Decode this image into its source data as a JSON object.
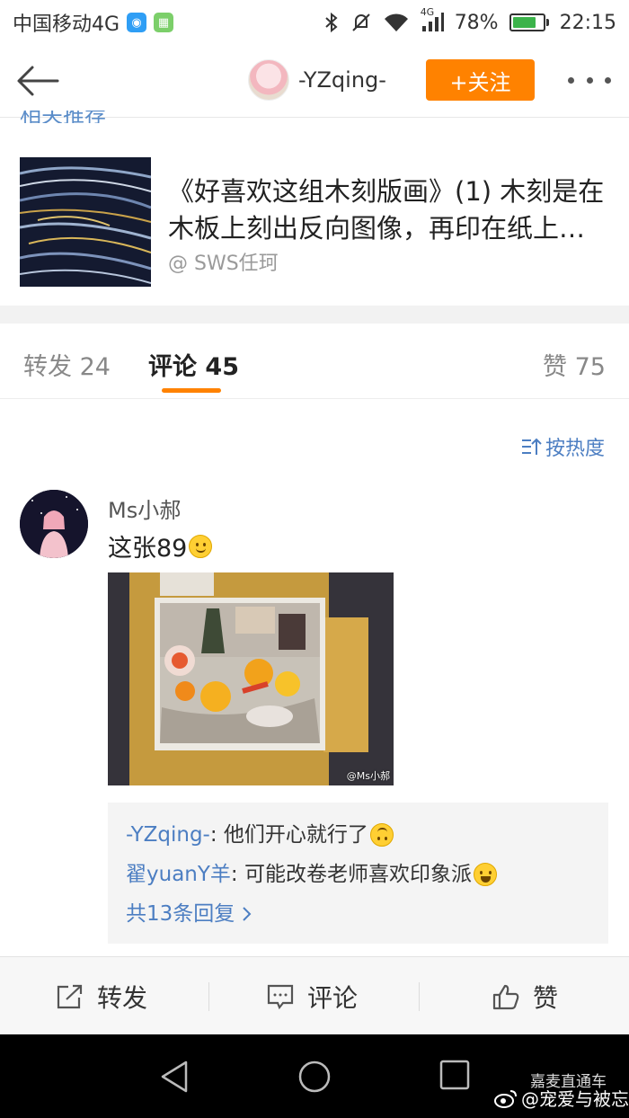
{
  "status_bar": {
    "carrier": "中国移动4G",
    "network_small": "4G",
    "battery": "78%",
    "battery_level": 0.78,
    "time": "22:15"
  },
  "nav": {
    "username": "-YZqing-",
    "follow_label": "+关注"
  },
  "cut_off_text": "相关推荐",
  "original_post": {
    "line1": "《好喜欢这组木刻版画》(1) 木刻是在",
    "line2": "木板上刻出反向图像，再印在纸上…",
    "author": "@ SWS任珂"
  },
  "tabs": {
    "repost_label": "转发",
    "repost_count": "24",
    "comment_label": "评论",
    "comment_count": "45",
    "like_label": "赞",
    "like_count": "75"
  },
  "sort_label": "按热度",
  "comment": {
    "author": "Ms小郝",
    "text": "这张89",
    "photo_watermark": "@Ms小郝",
    "replies": [
      {
        "name": "-YZqing-",
        "text": ": 他们开心就行了"
      },
      {
        "name": "翟yuanY羊",
        "text": ": 可能改卷老师喜欢印象派"
      }
    ],
    "more_replies": "共13条回复"
  },
  "actions": {
    "repost": "转发",
    "comment": "评论",
    "like": "赞"
  },
  "watermark": {
    "line1": "嘉麦直通车",
    "line2": "@宠爱与被忘"
  },
  "colors": {
    "accent": "#ff8200",
    "link": "#4c7ec2"
  }
}
